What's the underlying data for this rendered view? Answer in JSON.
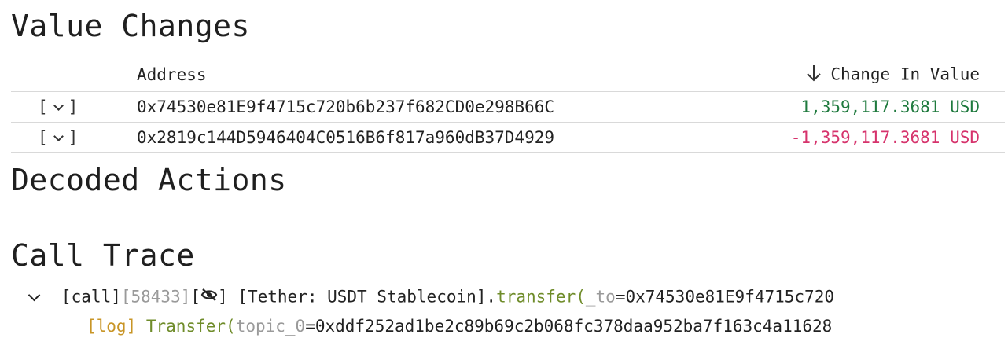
{
  "sections": {
    "value_changes": "Value Changes",
    "decoded_actions": "Decoded Actions",
    "call_trace": "Call Trace"
  },
  "value_table": {
    "headers": {
      "address": "Address",
      "change": "Change In Value"
    },
    "expand_label_open": "[",
    "expand_label_close": "]",
    "rows": [
      {
        "address": "0x74530e81E9f4715c720b6b237f682CD0e298B66C",
        "value": "1,359,117.3681 USD",
        "sign": "positive"
      },
      {
        "address": "0x2819c144D5946404C0516B6f817a960dB37D4929",
        "value": "-1,359,117.3681 USD",
        "sign": "negative"
      }
    ]
  },
  "trace": {
    "call": {
      "type": "[call]",
      "gas": "[58433]",
      "bracket_open": "[",
      "bracket_close": "]",
      "contract": "[Tether: USDT Stablecoin].",
      "function": "transfer",
      "paren": "(",
      "param_name": "_to",
      "param_value": "=0x74530e81E9f4715c720"
    },
    "log": {
      "type": "[log]",
      "event": "Transfer",
      "paren": "(",
      "param_name": "topic_0",
      "param_value": "=0xddf252ad1be2c89b69c2b068fc378daa952ba7f163c4a11628"
    }
  },
  "colors": {
    "positive": "#1f7a3e",
    "negative": "#d6336c",
    "function": "#6f8c2a",
    "log": "#c89526",
    "muted": "#9a9a9a"
  },
  "icons": {
    "expand": "chevron-down-icon",
    "sort": "arrow-down-icon",
    "hidden": "eye-off-icon",
    "trace_toggle": "chevron-down-icon"
  }
}
